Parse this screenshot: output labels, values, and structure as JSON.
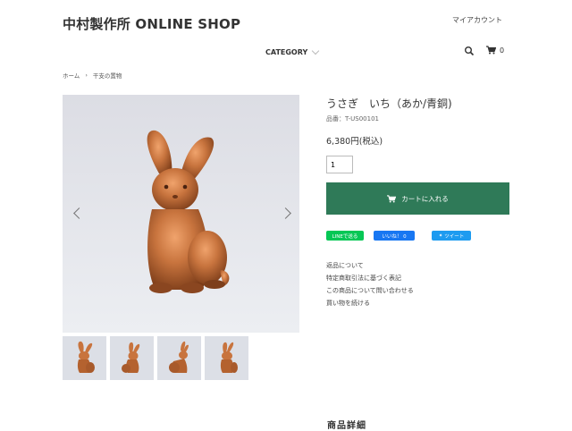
{
  "header": {
    "shop_title": "中村製作所 ONLINE SHOP",
    "my_account": "マイアカウント",
    "category_label": "CATEGORY",
    "cart_count": "0"
  },
  "breadcrumb": {
    "home": "ホーム",
    "current": "干支の置物"
  },
  "gallery": {
    "prev_icon": "chevron-left-icon",
    "next_icon": "chevron-right-icon",
    "thumbnail_count": 4
  },
  "product": {
    "name": "うさぎ　いち（あか/青銅)",
    "sku": "品番：T-US00101",
    "price": "6,380円(税込)",
    "quantity": "1",
    "add_to_cart": "カートに入れる"
  },
  "social": {
    "line": "LINEで送る",
    "facebook": "いいね！ 0",
    "twitter": "ツイート"
  },
  "links": [
    "返品について",
    "特定商取引法に基づく表記",
    "この商品について問い合わせる",
    "買い物を続ける"
  ],
  "section": {
    "detail_heading": "商品詳細"
  },
  "colors": {
    "cart_button": "#2f7a58",
    "line": "#06c755",
    "facebook": "#1877f2",
    "twitter": "#1d9bf0",
    "copper": "#c8743e"
  }
}
